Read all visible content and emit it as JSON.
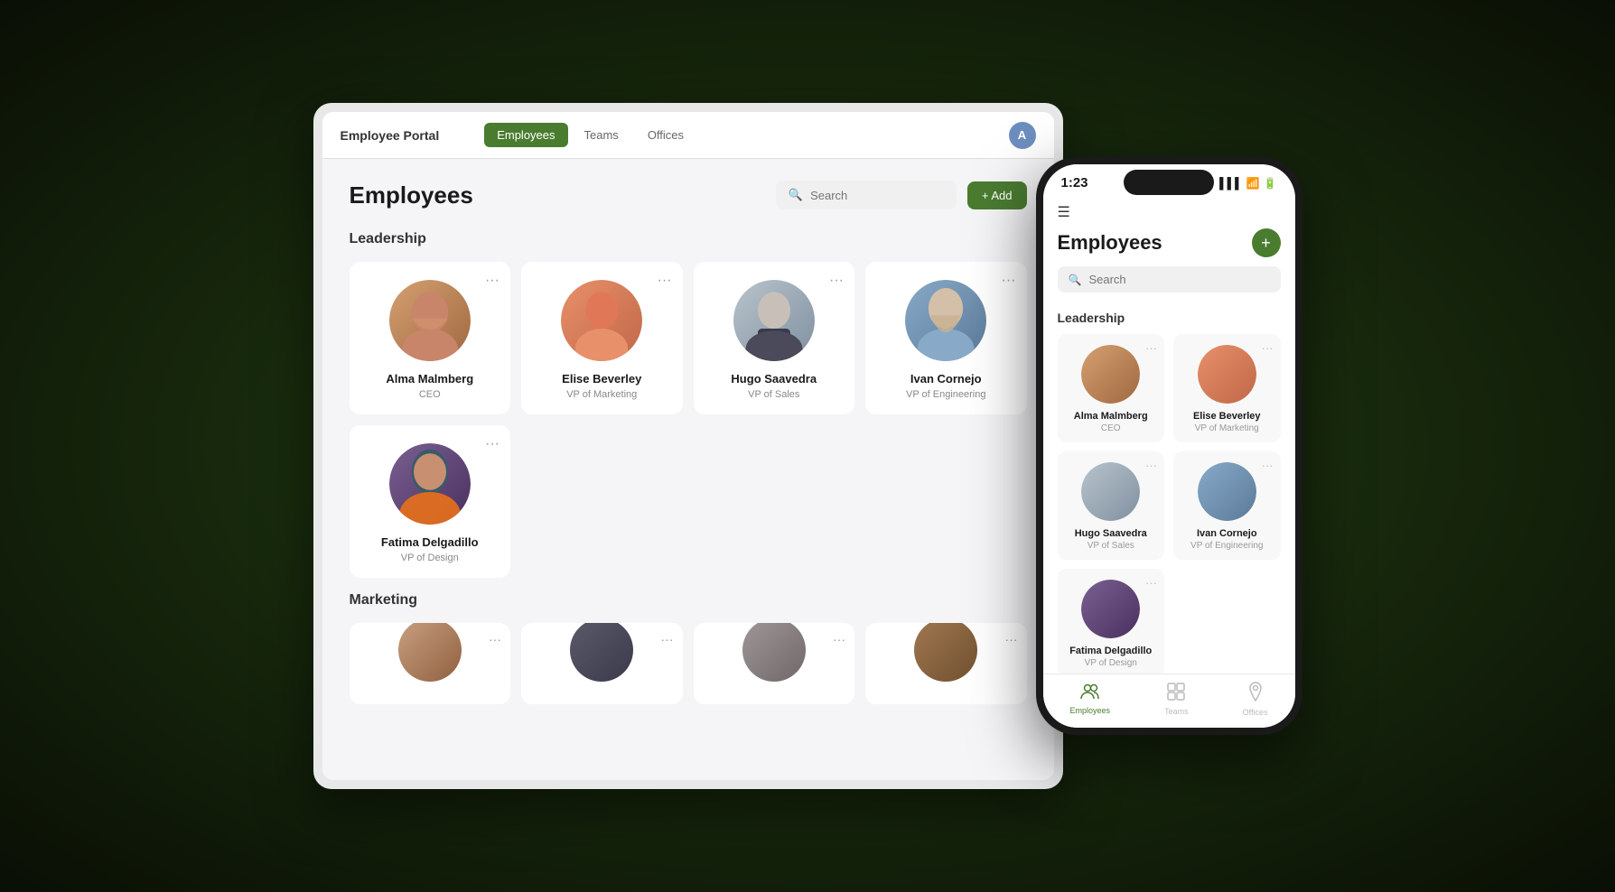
{
  "tablet": {
    "logo": "Employee Portal",
    "nav_tabs": [
      "Employees",
      "Teams",
      "Offices"
    ],
    "active_tab": "Employees",
    "avatar_letter": "A",
    "page_title": "Employees",
    "search_placeholder": "Search",
    "add_button": "+ Add",
    "sections": [
      {
        "title": "Leadership",
        "employees": [
          {
            "name": "Alma Malmberg",
            "job_title": "CEO",
            "color": "#c8956c"
          },
          {
            "name": "Elise Beverley",
            "job_title": "VP of Marketing",
            "color": "#e8856a"
          },
          {
            "name": "Hugo Saavedra",
            "job_title": "VP of Sales",
            "color": "#8a9bb0"
          },
          {
            "name": "Ivan Cornejo",
            "job_title": "VP of Engineering",
            "color": "#7aa0c0"
          }
        ]
      },
      {
        "title": "",
        "employees": [
          {
            "name": "Fatima Delgadillo",
            "job_title": "VP of Design",
            "color": "#5a3a5a"
          }
        ]
      },
      {
        "title": "Marketing",
        "employees": [
          {
            "name": "",
            "job_title": "",
            "color": "#c8a080"
          },
          {
            "name": "",
            "job_title": "",
            "color": "#3a3a4a"
          },
          {
            "name": "",
            "job_title": "",
            "color": "#9a9090"
          },
          {
            "name": "",
            "job_title": "",
            "color": "#7a6050"
          }
        ]
      }
    ]
  },
  "phone": {
    "time": "1:23",
    "title": "Employees",
    "search_placeholder": "Search",
    "menu_icon": "☰",
    "add_icon": "+",
    "sections": [
      {
        "title": "Leadership",
        "employees": [
          {
            "name": "Alma Malmberg",
            "job_title": "CEO",
            "color": "#c8956c"
          },
          {
            "name": "Elise Beverley",
            "job_title": "VP of Marketing",
            "color": "#e8856a"
          },
          {
            "name": "Hugo Saavedra",
            "job_title": "VP of Sales",
            "color": "#8a9bb0"
          },
          {
            "name": "Ivan Cornejo",
            "job_title": "VP of Engineering",
            "color": "#7aa0c0"
          }
        ]
      },
      {
        "title": "",
        "employees": [
          {
            "name": "Fatima Delgadillo",
            "job_title": "VP of Design",
            "color": "#5a3a5a"
          }
        ]
      }
    ],
    "nav_items": [
      {
        "label": "Employees",
        "icon": "👥",
        "active": true
      },
      {
        "label": "Teams",
        "icon": "⊞",
        "active": false
      },
      {
        "label": "Offices",
        "icon": "📍",
        "active": false
      }
    ]
  }
}
